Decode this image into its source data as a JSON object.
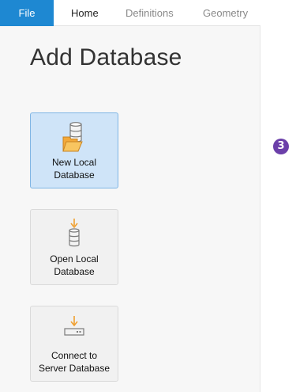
{
  "ribbon": {
    "tabs": [
      {
        "label": "File"
      },
      {
        "label": "Home"
      },
      {
        "label": "Definitions"
      },
      {
        "label": "Geometry"
      }
    ]
  },
  "section": {
    "title": "Add Database"
  },
  "buttons": {
    "new_local": {
      "line1": "New Local",
      "line2": "Database",
      "icon": "new-local-database-icon"
    },
    "open_local": {
      "line1": "Open Local",
      "line2": "Database",
      "icon": "open-local-database-icon"
    },
    "connect_server": {
      "line1": "Connect to",
      "line2": "Server Database",
      "icon": "server-database-icon"
    }
  },
  "callout": {
    "number": "3",
    "color": "#6b3fa9"
  },
  "colors": {
    "accent": "#1e88d2",
    "selected_bg": "#cfe4f8",
    "arrow": "#f0a030",
    "folder": "#f6b94c"
  }
}
